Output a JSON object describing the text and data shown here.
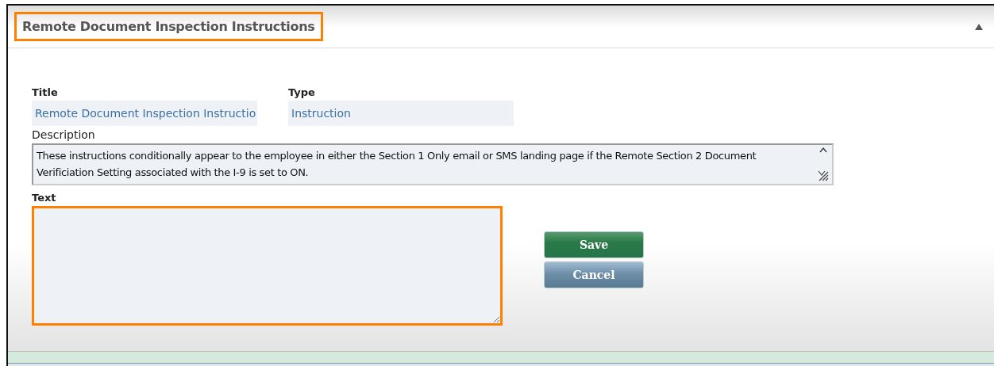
{
  "panel": {
    "title": "Remote Document Inspection Instructions",
    "title_highlighted": true,
    "expanded": true
  },
  "fields": {
    "title_label": "Title",
    "title_value": "Remote Document Inspection Instructio",
    "type_label": "Type",
    "type_value": "Instruction",
    "description_label": "Description",
    "description_value": "These instructions conditionally appear to the employee in either the Section 1 Only email or SMS landing page if the Remote Section 2 Document Verificiation Setting associated with the I-9 is set to ON.",
    "text_label": "Text",
    "text_highlighted": true
  },
  "buttons": [
    {
      "label": "Save",
      "kind": "primary"
    },
    {
      "label": "Cancel",
      "kind": "secondary"
    }
  ]
}
